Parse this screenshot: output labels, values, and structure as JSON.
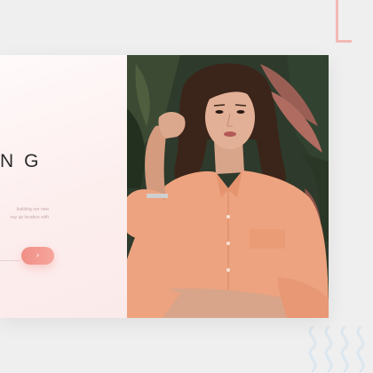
{
  "hero": {
    "headline_fragment": "NG",
    "body_lines": [
      "building our new",
      "say up location with"
    ],
    "cta_icon": "arrow-right-icon"
  },
  "decor": {
    "corner_color": "#f3b9b4",
    "wave_color": "#dce6ee"
  },
  "colors": {
    "accent": "#f08f86",
    "background": "#efefef",
    "card": "#ffffff",
    "headline": "#2b2b2b",
    "shirt": "#eda37f"
  },
  "photo": {
    "subject": "woman-portrait-photo"
  }
}
